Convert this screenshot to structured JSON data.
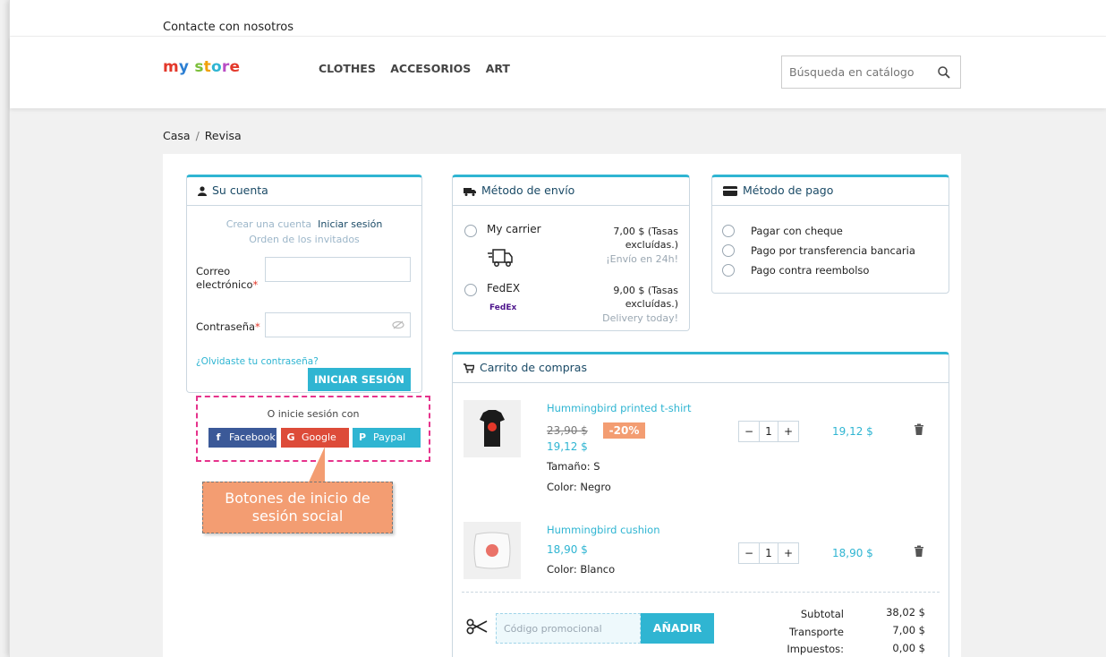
{
  "topbar": {
    "contact": "Contacte con nosotros"
  },
  "header": {
    "logo": [
      "m",
      "y",
      " ",
      "s",
      "t",
      "o",
      "r",
      "e"
    ],
    "nav": [
      "CLOTHES",
      "ACCESORIOS",
      "ART"
    ],
    "search_placeholder": "Búsqueda en catálogo"
  },
  "breadcrumb": [
    "Casa",
    "Revisa"
  ],
  "account": {
    "title": "Su cuenta",
    "create": "Crear una cuenta",
    "login": "Iniciar sesión",
    "guest": "Orden de los invitados",
    "email_label": "Correo electrónico",
    "password_label": "Contraseña",
    "forgot": "¿Olvidaste tu contraseña?",
    "submit": "INICIAR SESIÓN",
    "social_title": "O inicie sesión con",
    "social": [
      "Facebook",
      "Google",
      "Paypal"
    ]
  },
  "shipping": {
    "title": "Método de envío",
    "carriers": [
      {
        "name": "My carrier",
        "price": "7,00 $ (Tasas excluídas.)",
        "delay": "¡Envío en 24h!"
      },
      {
        "name": "FedEX",
        "price": "9,00 $ (Tasas excluídas.)",
        "delay": "Delivery today!"
      }
    ],
    "fedex_logo": "FedEx"
  },
  "payment": {
    "title": "Método de pago",
    "options": [
      "Pagar con cheque",
      "Pago por transferencia bancaria",
      "Pago contra reembolso"
    ]
  },
  "cart": {
    "title": "Carrito de compras",
    "items": [
      {
        "name": "Hummingbird printed t-shirt",
        "old_price": "23,90 $",
        "discount": "-20%",
        "price": "19,12 $",
        "size": "Tamaño: S",
        "color": "Color: Negro",
        "qty": "1",
        "total": "19,12 $"
      },
      {
        "name": "Hummingbird cushion",
        "price": "18,90 $",
        "color": "Color: Blanco",
        "qty": "1",
        "total": "18,90 $"
      }
    ],
    "promo_placeholder": "Código promocional",
    "add": "AÑADIR",
    "totals": [
      {
        "label": "Subtotal",
        "value": "38,02 $"
      },
      {
        "label": "Transporte",
        "value": "7,00 $"
      },
      {
        "label": "Impuestos:",
        "value": "0,00 $"
      }
    ]
  },
  "callout": {
    "text": "Botones de inicio de sesión social"
  },
  "colors": {
    "accent": "#2fb5d2",
    "callout": "#f39d72",
    "dashed": "#e6338c",
    "facebook": "#3b5998",
    "google": "#dd4b39"
  }
}
